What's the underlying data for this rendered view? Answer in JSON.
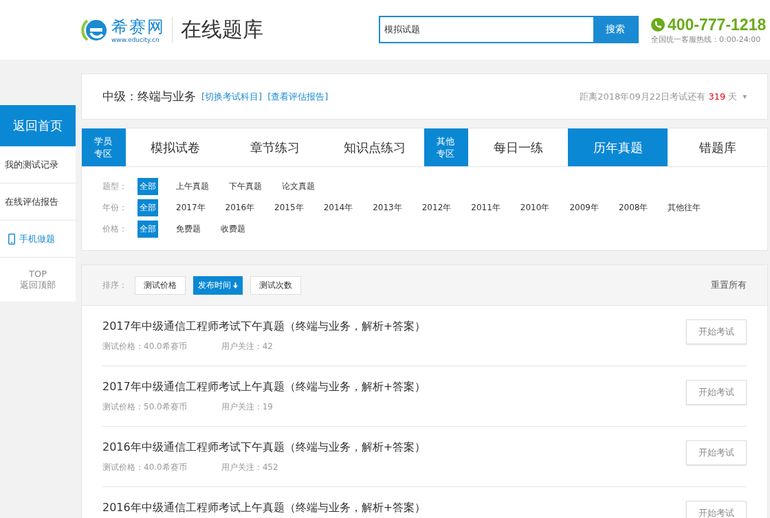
{
  "header": {
    "logo_name": "希赛网",
    "logo_url": "www.educity.cn",
    "site_title": "在线题库",
    "search": {
      "value": "模拟试题",
      "button": "搜索"
    },
    "hotline": {
      "number": "400-777-1218",
      "note": "全国统一客服热线：0:00-24:00"
    }
  },
  "sidebar": {
    "home": "返回首页",
    "items": [
      {
        "label": "我的测试记录",
        "kind": "plain"
      },
      {
        "label": "在线评估报告",
        "kind": "plain"
      },
      {
        "label": "手机做题",
        "kind": "mobile"
      }
    ],
    "top": {
      "label": "TOP",
      "sub": "返回顶部"
    }
  },
  "subject": {
    "title": "中级：终端与业务",
    "links": [
      "[切换考试科目]",
      "[查看评估报告]"
    ],
    "countdown": {
      "prefix": "距离2018年09月22日考试还有",
      "days": "319",
      "suffix": "天"
    },
    "caret": "▾"
  },
  "tabs": [
    {
      "label": "学员专区",
      "kind": "zone"
    },
    {
      "label": "模拟试卷",
      "kind": "tab",
      "selected": false
    },
    {
      "label": "章节练习",
      "kind": "tab",
      "selected": false
    },
    {
      "label": "知识点练习",
      "kind": "tab",
      "selected": false
    },
    {
      "label": "其他专区",
      "kind": "zone"
    },
    {
      "label": "每日一练",
      "kind": "tab",
      "selected": false
    },
    {
      "label": "历年真题",
      "kind": "tab",
      "selected": true
    },
    {
      "label": "错题库",
      "kind": "tab",
      "selected": false
    }
  ],
  "filters": [
    {
      "label": "题型：",
      "options": [
        {
          "label": "全部",
          "selected": true
        },
        {
          "label": "上午真题",
          "selected": false
        },
        {
          "label": "下午真题",
          "selected": false
        },
        {
          "label": "论文真题",
          "selected": false
        }
      ]
    },
    {
      "label": "年份：",
      "options": [
        {
          "label": "全部",
          "selected": true
        },
        {
          "label": "2017年",
          "selected": false
        },
        {
          "label": "2016年",
          "selected": false
        },
        {
          "label": "2015年",
          "selected": false
        },
        {
          "label": "2014年",
          "selected": false
        },
        {
          "label": "2013年",
          "selected": false
        },
        {
          "label": "2012年",
          "selected": false
        },
        {
          "label": "2011年",
          "selected": false
        },
        {
          "label": "2010年",
          "selected": false
        },
        {
          "label": "2009年",
          "selected": false
        },
        {
          "label": "2008年",
          "selected": false
        },
        {
          "label": "其他往年",
          "selected": false
        }
      ]
    },
    {
      "label": "价格：",
      "options": [
        {
          "label": "全部",
          "selected": true
        },
        {
          "label": "免费题",
          "selected": false
        },
        {
          "label": "收费题",
          "selected": false
        }
      ]
    }
  ],
  "sort": {
    "label": "排序：",
    "options": [
      {
        "label": "测试价格",
        "selected": false
      },
      {
        "label": "发布时间",
        "selected": true
      },
      {
        "label": "测试次数",
        "selected": false
      }
    ],
    "reset": "重置所有"
  },
  "papers": [
    {
      "title": "2017年中级通信工程师考试下午真题（终端与业务，解析+答案）",
      "price": "测试价格：40.0希赛币",
      "followers": "用户关注：42",
      "button": "开始考试"
    },
    {
      "title": "2017年中级通信工程师考试上午真题（终端与业务，解析+答案）",
      "price": "测试价格：50.0希赛币",
      "followers": "用户关注：19",
      "button": "开始考试"
    },
    {
      "title": "2016年中级通信工程师考试下午真题（终端与业务，解析+答案）",
      "price": "测试价格：40.0希赛币",
      "followers": "用户关注：452",
      "button": "开始考试"
    },
    {
      "title": "2016年中级通信工程师考试上午真题（终端与业务，解析+答案）",
      "button": "开始考试"
    }
  ]
}
